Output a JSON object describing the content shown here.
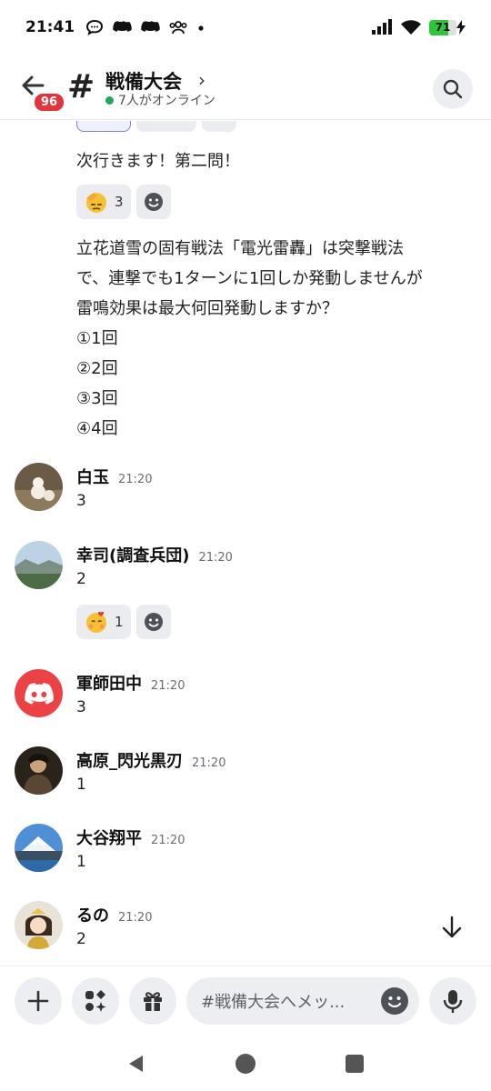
{
  "status_bar": {
    "time": "21:41",
    "battery_level": "71",
    "battery_fraction": 0.71
  },
  "header": {
    "unread_count": "96",
    "hash_symbol": "#",
    "channel_name": "戦備大会",
    "chevron": "›",
    "online_text": "7人がオンライン"
  },
  "messages": {
    "msg1_text": "次行きます！第二問！",
    "msg1_reaction_count": "3",
    "msg2_lines": [
      "立花道雪の固有戦法「電光雷轟」は突撃戦法",
      "で、連撃でも1ターンに1回しか発動しませんが",
      "雷鳴効果は最大何回発動しますか？",
      "①1回",
      "②2回",
      "③3回",
      "④4回"
    ],
    "posts": [
      {
        "author": "白玉",
        "time": "21:20",
        "text": "3"
      },
      {
        "author": "幸司(調査兵団)",
        "time": "21:20",
        "text": "2",
        "reaction_count": "1"
      },
      {
        "author": "軍師田中",
        "time": "21:20",
        "text": "3"
      },
      {
        "author": "高原_閃光黒刃",
        "time": "21:20",
        "text": "1"
      },
      {
        "author": "大谷翔平",
        "time": "21:20",
        "text": "1"
      },
      {
        "author": "るの",
        "time": "21:20",
        "text": "2"
      }
    ]
  },
  "composer": {
    "placeholder": "#戦備大会へメッ..."
  },
  "colors": {
    "online": "#23a55a",
    "badge": "#e0353d",
    "discord_red": "#ed4245",
    "battery": "#2fc53a"
  },
  "icons": [
    "back-arrow-icon",
    "search-icon",
    "plus-icon",
    "apps-icon",
    "gift-icon",
    "emoji-icon",
    "mic-icon",
    "jump-down-icon",
    "nav-back-icon",
    "nav-home-icon",
    "nav-recents-icon"
  ]
}
